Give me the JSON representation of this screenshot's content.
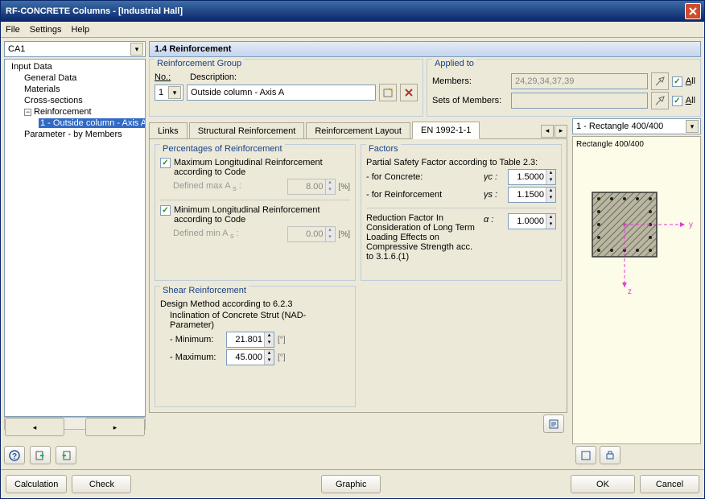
{
  "window": {
    "title": "RF-CONCRETE Columns - [Industrial Hall]"
  },
  "menu": {
    "file": "File",
    "settings": "Settings",
    "help": "Help"
  },
  "sidebar": {
    "combo": "CA1",
    "root": "Input Data",
    "items": {
      "general": "General Data",
      "materials": "Materials",
      "cross": "Cross-sections",
      "reinf": "Reinforcement",
      "reinf_child": "1 - Outside column - Axis A",
      "param": "Parameter - by Members"
    }
  },
  "header": "1.4 Reinforcement",
  "group": {
    "title": "Reinforcement Group",
    "no_lbl": "No.:",
    "no_val": "1",
    "desc_lbl": "Description:",
    "desc_val": "Outside column - Axis A"
  },
  "applied": {
    "title": "Applied to",
    "members_lbl": "Members:",
    "members_val": "24,29,34,37,39",
    "sets_lbl": "Sets of Members:",
    "sets_val": "",
    "all": "All"
  },
  "tabs": {
    "t1": "Links",
    "t2": "Structural Reinforcement",
    "t3": "Reinforcement Layout",
    "t4": "EN 1992-1-1"
  },
  "perc": {
    "title": "Percentages of Reinforcement",
    "max_chk": "Maximum Longitudinal Reinforcement according to Code",
    "max_def": "Defined max A",
    "max_val": "8.00",
    "min_chk": "Minimum Longitudinal Reinforcement according to Code",
    "min_def": "Defined min A",
    "min_val": "0.00",
    "unit": "[%]"
  },
  "shear": {
    "title": "Shear Reinforcement",
    "method": "Design Method according to 6.2.3",
    "incl": "Inclination of Concrete Strut (NAD-Parameter)",
    "min_lbl": "- Minimum:",
    "min_val": "21.801",
    "max_lbl": "- Maximum:",
    "max_val": "45.000",
    "deg": "[°]"
  },
  "factors": {
    "title": "Factors",
    "psf": "Partial Safety Factor according to Table 2.3:",
    "concrete_lbl": "- for Concrete:",
    "concrete_sym": "γc :",
    "concrete_val": "1.5000",
    "reinf_lbl": "- for Reinforcement",
    "reinf_sym": "γs :",
    "reinf_val": "1.1500",
    "red": "Reduction Factor In Consideration of Long Term Loading Effects on Compressive Strength acc. to 3.1.6.(1)",
    "red_sym": "α :",
    "red_val": "1.0000"
  },
  "preview": {
    "combo": "1 - Rectangle 400/400",
    "label": "Rectangle 400/400",
    "y": "y",
    "z": "z"
  },
  "buttons": {
    "calc": "Calculation",
    "check": "Check",
    "graphic": "Graphic",
    "ok": "OK",
    "cancel": "Cancel"
  }
}
